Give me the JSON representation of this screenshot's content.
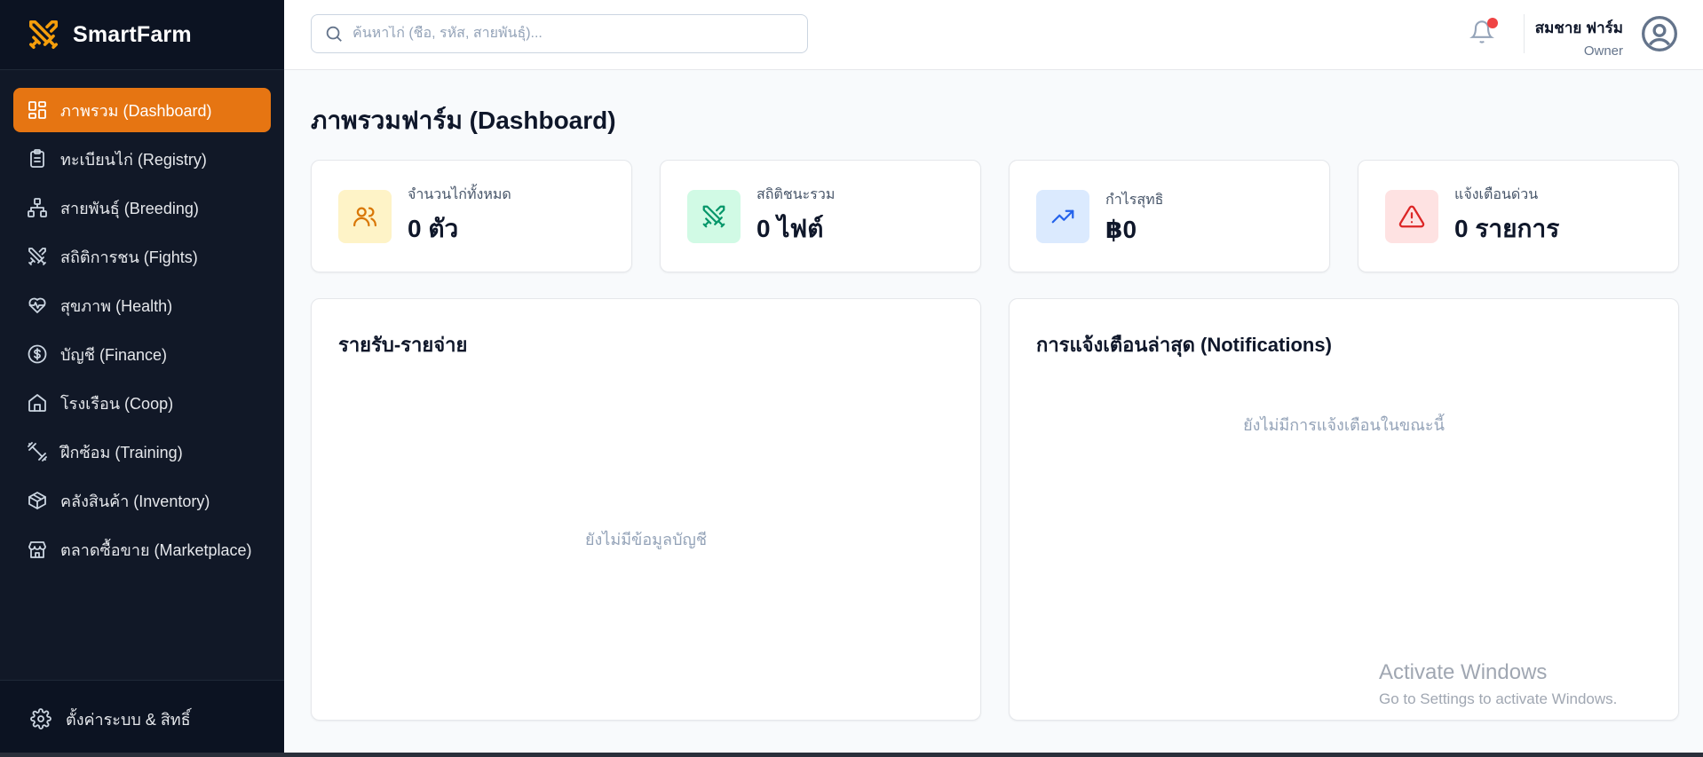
{
  "app": {
    "name": "SmartFarm"
  },
  "sidebar": {
    "items": [
      {
        "label": "ภาพรวม (Dashboard)",
        "icon": "dashboard-icon",
        "active": true
      },
      {
        "label": "ทะเบียนไก่ (Registry)",
        "icon": "clipboard-icon"
      },
      {
        "label": "สายพันธุ์ (Breeding)",
        "icon": "network-icon"
      },
      {
        "label": "สถิติการชน (Fights)",
        "icon": "crossed-swords-icon"
      },
      {
        "label": "สุขภาพ (Health)",
        "icon": "heart-pulse-icon"
      },
      {
        "label": "บัญชี (Finance)",
        "icon": "dollar-circle-icon"
      },
      {
        "label": "โรงเรือน (Coop)",
        "icon": "house-icon"
      },
      {
        "label": "ฝึกซ้อม (Training)",
        "icon": "dumbbell-icon"
      },
      {
        "label": "คลังสินค้า (Inventory)",
        "icon": "package-icon"
      },
      {
        "label": "ตลาดซื้อขาย (Marketplace)",
        "icon": "store-icon"
      }
    ],
    "footer_label": "ตั้งค่าระบบ & สิทธิ์"
  },
  "header": {
    "search_placeholder": "ค้นหาไก่ (ชื่อ, รหัส, สายพันธุ์)...",
    "user_name": "สมชาย ฟาร์ม",
    "user_role": "Owner"
  },
  "main": {
    "title": "ภาพรวมฟาร์ม (Dashboard)",
    "stats": [
      {
        "label": "จำนวนไก่ทั้งหมด",
        "value": "0 ตัว",
        "icon": "users-icon",
        "color": "#d97706",
        "bg": "#fef3c7"
      },
      {
        "label": "สถิติชนะรวม",
        "value": "0 ไฟต์",
        "icon": "crossed-swords-icon",
        "color": "#059669",
        "bg": "#d1fae5"
      },
      {
        "label": "กำไรสุทธิ",
        "value": "฿0",
        "icon": "trending-up-icon",
        "color": "#2563eb",
        "bg": "#dbeafe"
      },
      {
        "label": "แจ้งเตือนด่วน",
        "value": "0 รายการ",
        "icon": "alert-triangle-icon",
        "color": "#dc2626",
        "bg": "#fee2e2"
      }
    ],
    "finance_panel": {
      "title": "รายรับ-รายจ่าย",
      "empty": "ยังไม่มีข้อมูลบัญชี"
    },
    "notifications_panel": {
      "title": "การแจ้งเตือนล่าสุด (Notifications)",
      "empty": "ยังไม่มีการแจ้งเตือนในขณะนี้"
    }
  },
  "watermark": {
    "line1": "Activate Windows",
    "line2": "Go to Settings to activate Windows."
  },
  "colors": {
    "accent": "#e67512",
    "sidebar_bg": "#111827",
    "notification_dot": "#ef4444"
  }
}
